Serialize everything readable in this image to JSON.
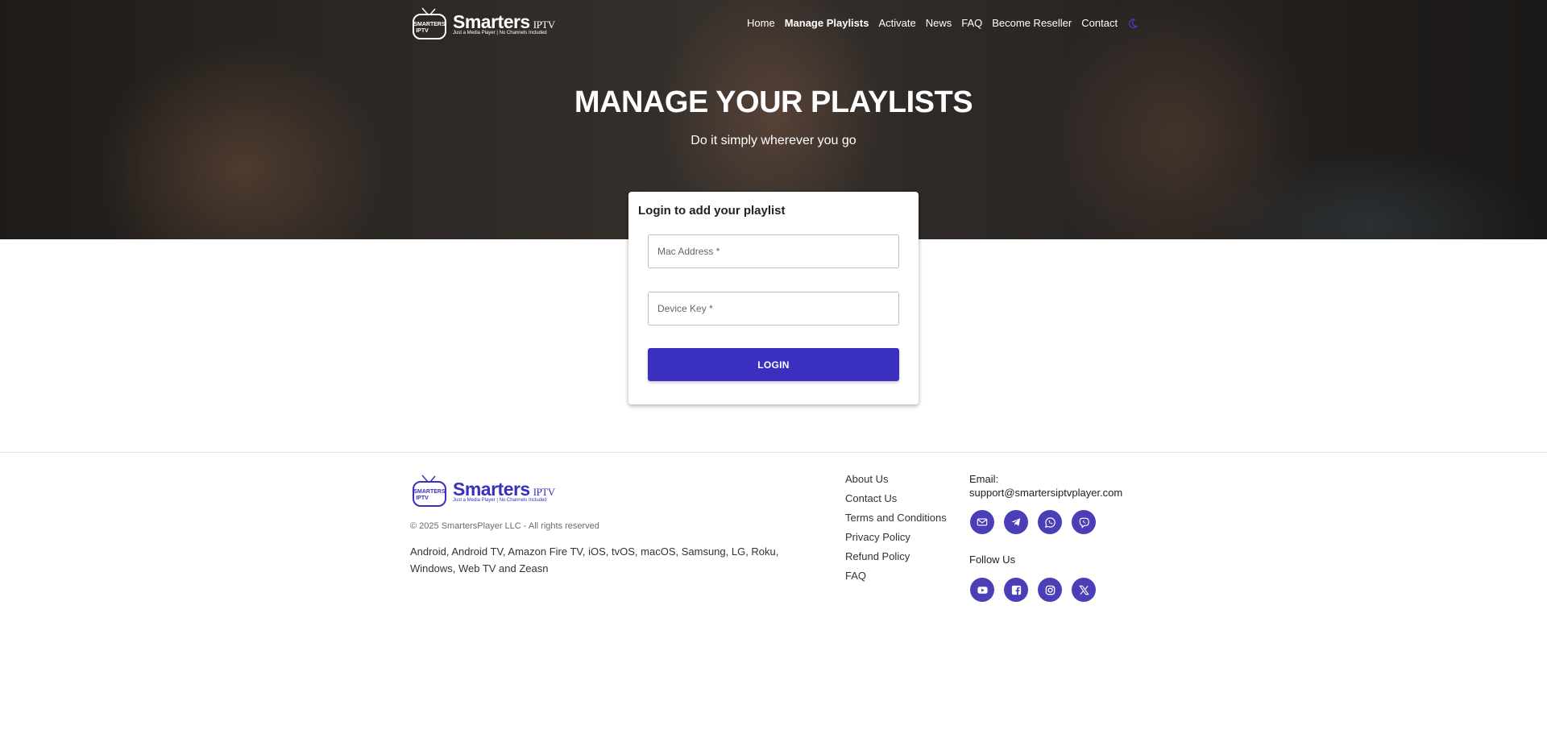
{
  "header": {
    "logo": {
      "word": "Smarters",
      "suffix": "IPTV",
      "badge": "SMARTERS IPTV",
      "tagline": "Just a Media Player | No Channels Included"
    },
    "nav": [
      {
        "label": "Home"
      },
      {
        "label": "Manage Playlists",
        "active": true
      },
      {
        "label": "Activate"
      },
      {
        "label": "News"
      },
      {
        "label": "FAQ"
      },
      {
        "label": "Become Reseller"
      },
      {
        "label": "Contact"
      }
    ],
    "theme_toggle_icon": "moon-icon"
  },
  "hero": {
    "title": "MANAGE YOUR PLAYLISTS",
    "subtitle": "Do it simply wherever you go"
  },
  "login": {
    "title": "Login to add your playlist",
    "mac_placeholder": "Mac Address *",
    "key_placeholder": "Device Key *",
    "button": "LOGIN"
  },
  "footer": {
    "copyright": "© 2025  SmartersPlayer LLC - All rights reserved",
    "platforms": "Android, Android TV, Amazon Fire TV, iOS, tvOS, macOS, Samsung, LG, Roku, Windows, Web TV and Zeasn",
    "links": [
      "About Us",
      "Contact Us",
      "Terms and Conditions",
      "Privacy Policy",
      "Refund Policy",
      "FAQ"
    ],
    "email_label": "Email:",
    "email": "support@smartersiptvplayer.com",
    "contact_icons": [
      "mail-icon",
      "telegram-icon",
      "whatsapp-icon",
      "viber-icon"
    ],
    "follow_label": "Follow Us",
    "social_icons": [
      "youtube-icon",
      "facebook-icon",
      "instagram-icon",
      "x-icon"
    ]
  },
  "colors": {
    "accent": "#3b2fbf",
    "icon_bg": "#4b3fb8"
  }
}
